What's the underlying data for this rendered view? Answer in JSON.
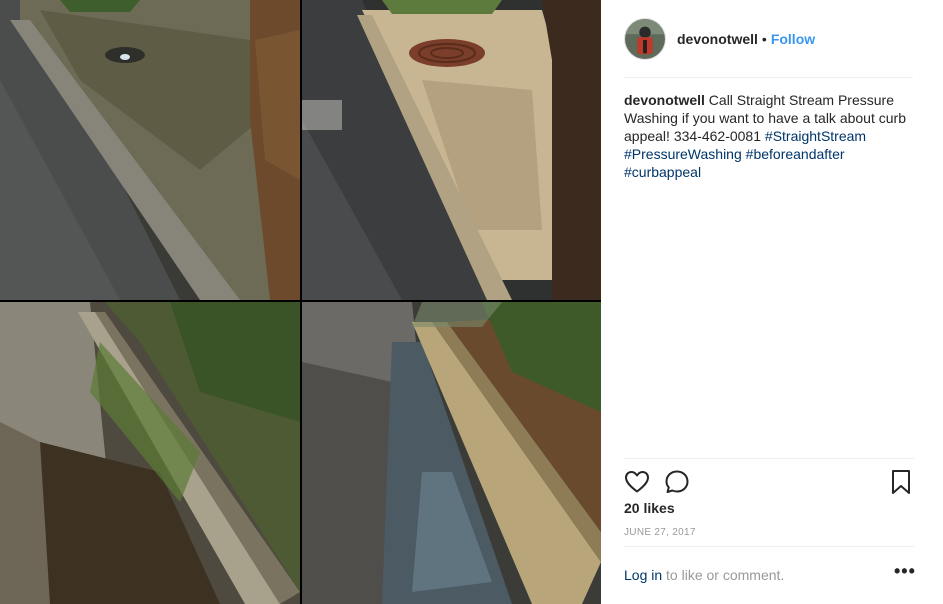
{
  "post": {
    "username": "devonotwell",
    "separator": "•",
    "follow_label": "Follow",
    "caption": {
      "user": "devonotwell",
      "text": "Call Straight Stream Pressure Washing if you want to have a talk about curb appeal! 334-462-0081",
      "hashtags": [
        "#StraightStream",
        "#PressureWashing",
        "#beforeandafter",
        "#curbappeal"
      ]
    },
    "likes": "20 likes",
    "date": "JUNE 27, 2017",
    "login_link": "Log in",
    "login_suffix": " to like or comment.",
    "more_label": "•••"
  },
  "icons": {
    "heart": "heart-icon",
    "comment": "comment-icon",
    "bookmark": "bookmark-icon",
    "more": "more-options-icon"
  },
  "photo": {
    "description_free": true,
    "panels": [
      "before-curb-top",
      "after-curb-top",
      "before-curb-bottom",
      "after-curb-bottom"
    ]
  },
  "colors": {
    "link": "#3897f0",
    "hashtag": "#003569",
    "text": "#262626",
    "muted": "#999999",
    "divider": "#efefef"
  }
}
